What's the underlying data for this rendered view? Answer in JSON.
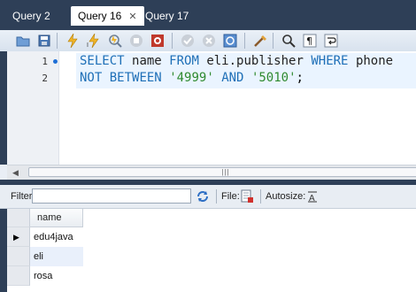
{
  "tabs": [
    {
      "label": "Query 2",
      "active": false
    },
    {
      "label": "Query 16",
      "active": true,
      "close": "✕"
    },
    {
      "label": "Query 17",
      "active": false
    }
  ],
  "toolbar": {
    "icons": [
      "open-folder-icon",
      "save-icon",
      "execute-icon",
      "execute-current-icon",
      "explain-icon",
      "stop-icon",
      "toggle-continue-on-error-icon",
      "commit-icon",
      "rollback-icon",
      "autocommit-icon",
      "beautify-icon",
      "find-icon",
      "toggle-invisible-chars-icon",
      "wrap-lines-icon"
    ]
  },
  "editor": {
    "lines": [
      {
        "number": "1",
        "text": "SELECT name FROM eli.publisher WHERE phone"
      },
      {
        "number": "2",
        "text": "NOT BETWEEN '4999' AND '5010';"
      }
    ]
  },
  "hscroll": {
    "left_arrow": "◀",
    "grip": "|||"
  },
  "results_toolbar": {
    "filter_label": "Filter:",
    "filter_value": "",
    "file_label": "File:",
    "autosize_label": "Autosize:"
  },
  "grid": {
    "columns": [
      "name"
    ],
    "rows": [
      {
        "name": "edu4java",
        "current": true
      },
      {
        "name": "eli",
        "current": false
      },
      {
        "name": "rosa",
        "current": false
      }
    ],
    "row_marker": "▶"
  },
  "colors": {
    "chrome": "#2e3f57",
    "keyword": "#1e6fb7",
    "string": "#2f8a2f"
  }
}
